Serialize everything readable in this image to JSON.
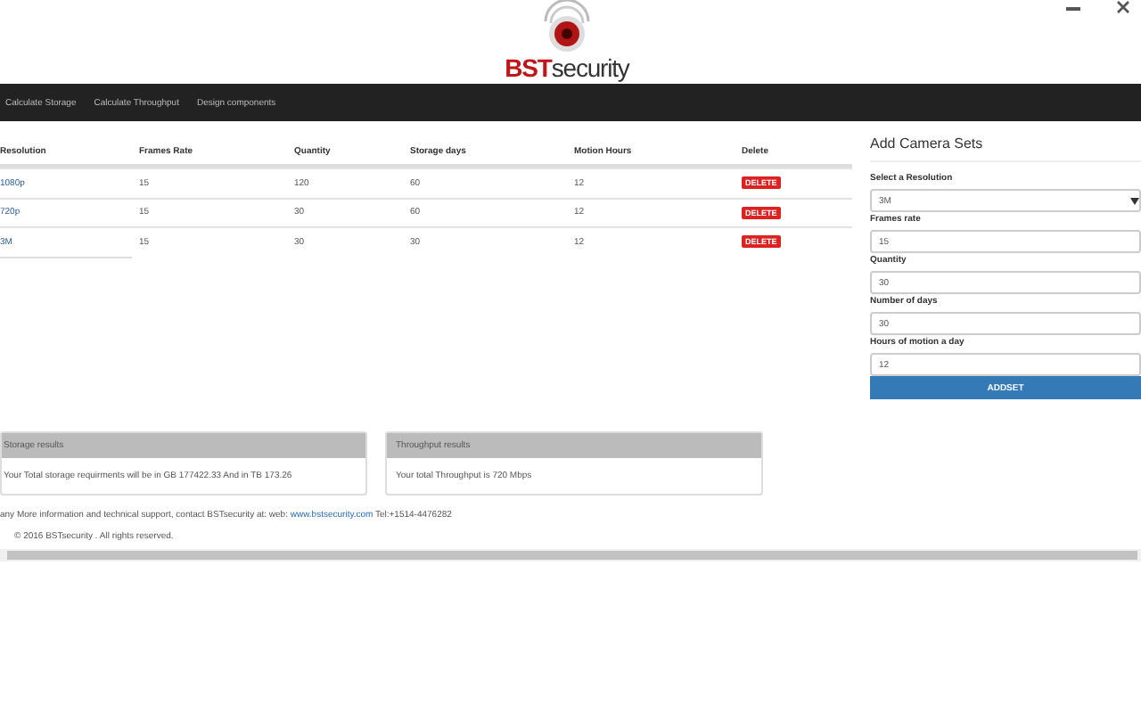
{
  "logo": {
    "brand": "BST",
    "suffix": "security"
  },
  "nav": [
    "Calculate Storage",
    "Calculate Throughput",
    "Design components"
  ],
  "table": {
    "columns": [
      "Resolution",
      "Frames Rate",
      "Quantity",
      "Storage days",
      "Motion Hours",
      "Delete"
    ],
    "rows": [
      {
        "cells": [
          "1080p",
          "15",
          "120",
          "60",
          "12"
        ],
        "action": "DELETE"
      },
      {
        "cells": [
          "720p",
          "15",
          "30",
          "60",
          "12"
        ],
        "action": "DELETE"
      },
      {
        "cells": [
          "3M",
          "15",
          "30",
          "30",
          "12"
        ],
        "action": "DELETE"
      }
    ]
  },
  "form": {
    "title": "Add Camera Sets",
    "fields": [
      {
        "kind": "select",
        "label": "Select a Resolution",
        "value": "3M"
      },
      {
        "kind": "input",
        "label": "Frames rate",
        "value": "15"
      },
      {
        "kind": "input",
        "label": "Quantity",
        "value": "30"
      },
      {
        "kind": "input",
        "label": "Number of days",
        "value": "30"
      },
      {
        "kind": "input",
        "label": "Hours of motion a day",
        "value": "12"
      }
    ],
    "button": "ADDSET"
  },
  "results": [
    {
      "title": "Storage results",
      "text": "Your Total storage requirments will be in GB 177422.33 And in TB 173.26"
    },
    {
      "title": "Throughput results",
      "text": "Your total Throughput is 720 Mbps"
    }
  ],
  "footer": {
    "before": "any More information and technical support, contact BSTsecurity at: web: ",
    "link": "www.bstsecurity.com",
    "after": " Tel:+1514-4476282",
    "copyright": "© 2016 BSTsecurity . All rights reserved."
  }
}
